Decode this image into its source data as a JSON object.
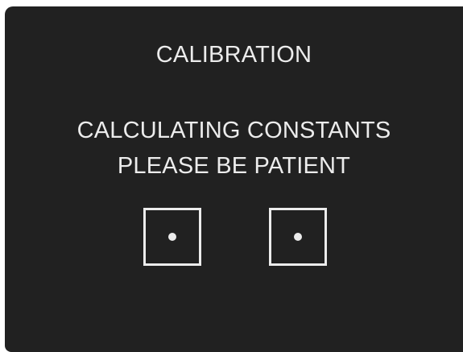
{
  "screen": {
    "title": "CALIBRATION",
    "message_line_1": "CALCULATING CONSTANTS",
    "message_line_2": "PLEASE BE PATIENT"
  },
  "targets": [
    {
      "icon": "calibration-target-icon"
    },
    {
      "icon": "calibration-target-icon"
    }
  ],
  "colors": {
    "background": "#212121",
    "foreground": "#ececec",
    "page": "#ffffff"
  }
}
